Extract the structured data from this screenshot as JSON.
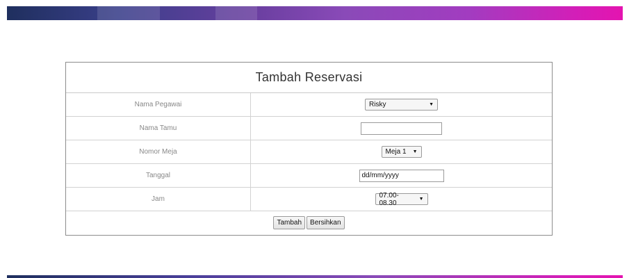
{
  "form": {
    "title": "Tambah Reservasi",
    "fields": [
      {
        "label": "Nama Pegawai",
        "value": "Risky"
      },
      {
        "label": "Nama Tamu",
        "value": ""
      },
      {
        "label": "Nomor Meja",
        "value": "Meja 1"
      },
      {
        "label": "Tanggal",
        "value": "dd/mm/yyyy"
      },
      {
        "label": "Jam",
        "value": "07.00-08.30"
      }
    ],
    "buttons": {
      "submit": "Tambah",
      "reset": "Bersihkan"
    }
  },
  "colors": {
    "banner_start": "#1f2f5e",
    "banner_end": "#e414b0",
    "border": "#8c8c8c"
  },
  "icons": {
    "dropdown": "triangle-down-icon"
  }
}
